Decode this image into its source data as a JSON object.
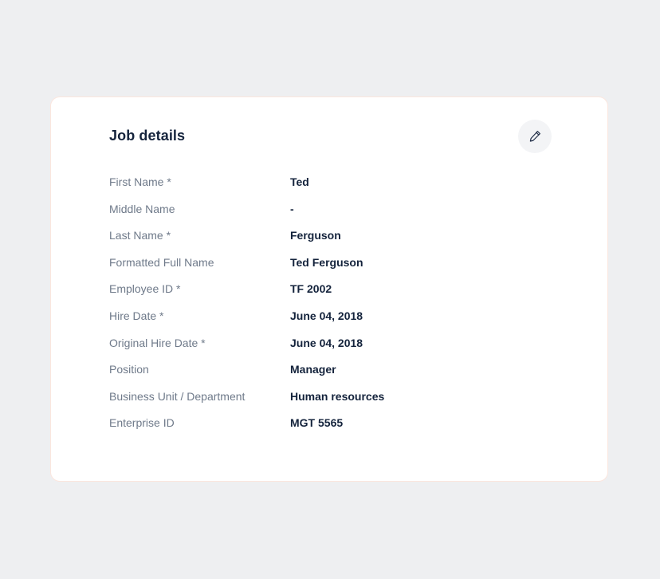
{
  "card": {
    "title": "Job details",
    "edit_icon": "pencil-icon",
    "accent_border": "#fbe6de",
    "fields": [
      {
        "label": "First Name *",
        "value": "Ted"
      },
      {
        "label": "Middle Name",
        "value": "-"
      },
      {
        "label": "Last Name *",
        "value": "Ferguson"
      },
      {
        "label": "Formatted Full Name",
        "value": "Ted Ferguson"
      },
      {
        "label": "Employee ID *",
        "value": "TF 2002"
      },
      {
        "label": "Hire Date *",
        "value": "June 04, 2018"
      },
      {
        "label": "Original Hire Date *",
        "value": "June 04, 2018"
      },
      {
        "label": "Position",
        "value": "Manager"
      },
      {
        "label": "Business Unit / Department",
        "value": "Human resources"
      },
      {
        "label": "Enterprise ID",
        "value": "MGT 5565"
      }
    ]
  }
}
